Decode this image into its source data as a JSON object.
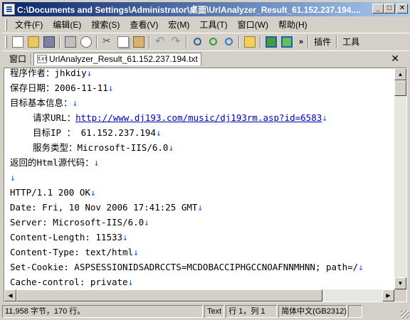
{
  "window": {
    "title": "C:\\Documents and Settings\\Administrator\\桌面\\UrlAnalyzer_Result_61.152.237.194...."
  },
  "caption_buttons": {
    "minimize": "_",
    "maximize": "□",
    "close": "✕"
  },
  "menu": [
    "文件(F)",
    "编辑(E)",
    "搜索(S)",
    "查看(V)",
    "宏(M)",
    "工具(T)",
    "窗口(W)",
    "帮助(H)"
  ],
  "toolbar": {
    "chevron": "»",
    "plugins_label": "插件",
    "tools_label": "工具"
  },
  "tabbar": {
    "window_label": "窗口",
    "tab_icon_text": "txt",
    "tab_label": "UrlAnalyzer_Result_61.152.237.194.txt",
    "close_glyph": "✕"
  },
  "editor": {
    "eol_marker": "↓",
    "lines": [
      {
        "text": "程序作者：jhkdiy",
        "indent": false
      },
      {
        "text": "保存日期：2006-11-11",
        "indent": false
      },
      {
        "text": "目标基本信息：",
        "indent": false
      },
      {
        "prefix": "请求URL：",
        "link": "http://www.dj193.com/music/dj193rm.asp?id=6583",
        "indent": true
      },
      {
        "text": "目标IP ： 61.152.237.194",
        "indent": true
      },
      {
        "text": "服务类型：Microsoft-IIS/6.0",
        "indent": true
      },
      {
        "text": "返回的Html源代码：",
        "indent": false
      },
      {
        "text": "",
        "indent": false
      },
      {
        "text": "HTTP/1.1 200 OK",
        "indent": false
      },
      {
        "text": "Date: Fri, 10 Nov 2006 17:41:25 GMT",
        "indent": false
      },
      {
        "text": "Server: Microsoft-IIS/6.0",
        "indent": false
      },
      {
        "text": "Content-Length: 11533",
        "indent": false
      },
      {
        "text": "Content-Type: text/html",
        "indent": false
      },
      {
        "text": "Set-Cookie: ASPSESSIONIDSADRCCTS=MCDOBACCIPHGCCNOAFNNMHNN; path=/",
        "indent": false
      },
      {
        "text": "Cache-control: private",
        "indent": false
      }
    ]
  },
  "scroll": {
    "up": "▲",
    "down": "▼",
    "left": "◀",
    "right": "▶"
  },
  "status": {
    "size": "11,958 字节，170 行。",
    "mode": "Text",
    "position": "行 1，列 1",
    "encoding": "简体中文(GB2312)"
  }
}
